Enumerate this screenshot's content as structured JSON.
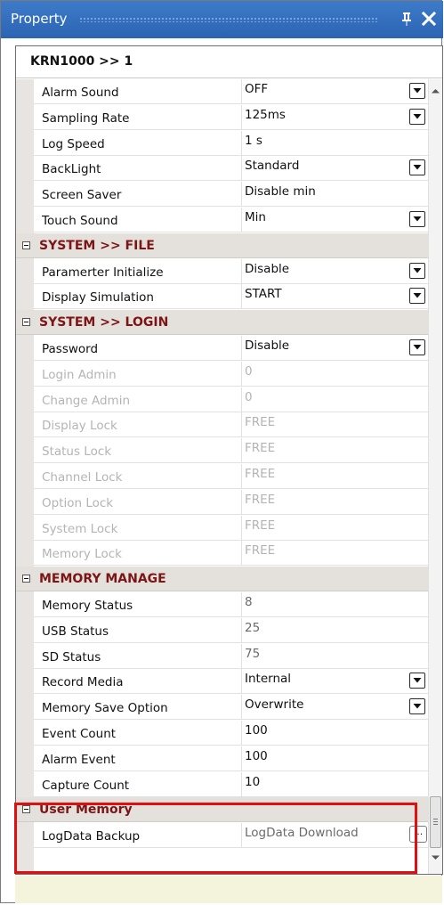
{
  "window": {
    "title": "Property"
  },
  "grid": {
    "header": "KRN1000 >> 1",
    "top_group": [
      {
        "name": "Alarm Sound",
        "value": "OFF",
        "dropdown": true
      },
      {
        "name": "Sampling Rate",
        "value": "125ms",
        "dropdown": true
      },
      {
        "name": "Log Speed",
        "value": "1 s",
        "dropdown": false
      },
      {
        "name": "BackLight",
        "value": "Standard",
        "dropdown": true
      },
      {
        "name": "Screen Saver",
        "value": "Disable min",
        "dropdown": false
      },
      {
        "name": "Touch Sound",
        "value": "Min",
        "dropdown": true
      }
    ],
    "file": {
      "label": "SYSTEM >> FILE",
      "items": [
        {
          "name": "Paramerter Initialize",
          "value": "Disable",
          "dropdown": true
        },
        {
          "name": "Display Simulation",
          "value": "START",
          "dropdown": true
        }
      ]
    },
    "login": {
      "label": "SYSTEM >> LOGIN",
      "items": [
        {
          "name": "Password",
          "value": "Disable",
          "dropdown": true
        },
        {
          "name": "Login Admin",
          "value": "0",
          "disabled": true
        },
        {
          "name": "Change Admin",
          "value": "0",
          "disabled": true
        },
        {
          "name": "Display Lock",
          "value": "FREE",
          "disabled": true
        },
        {
          "name": "Status Lock",
          "value": "FREE",
          "disabled": true
        },
        {
          "name": "Channel Lock",
          "value": "FREE",
          "disabled": true
        },
        {
          "name": "Option Lock",
          "value": "FREE",
          "disabled": true
        },
        {
          "name": "System Lock",
          "value": "FREE",
          "disabled": true
        },
        {
          "name": "Memory Lock",
          "value": "FREE",
          "disabled": true
        }
      ]
    },
    "memory": {
      "label": "MEMORY MANAGE",
      "items": [
        {
          "name": "Memory Status",
          "value": "8",
          "readonly": true
        },
        {
          "name": "USB Status",
          "value": "25",
          "readonly": true
        },
        {
          "name": "SD Status",
          "value": "75",
          "readonly": true
        },
        {
          "name": "Record Media",
          "value": "Internal",
          "dropdown": true
        },
        {
          "name": "Memory Save Option",
          "value": "Overwrite",
          "dropdown": true
        },
        {
          "name": "Event Count",
          "value": "100"
        },
        {
          "name": "Alarm Event",
          "value": "100"
        },
        {
          "name": "Capture Count",
          "value": "10"
        }
      ]
    },
    "user_memory": {
      "label": "User Memory",
      "items": [
        {
          "name": "LogData Backup",
          "value": "LogData Download",
          "readonly": true,
          "ellipsis": "..."
        }
      ]
    }
  },
  "colors": {
    "titlebar": "#2b64b3",
    "category_text": "#7c1616",
    "highlight": "#e01010",
    "footer": "#f4f3dc"
  },
  "icons": {
    "pin": "pin-icon",
    "close": "close-icon",
    "dropdown": "chevron-down-icon"
  }
}
